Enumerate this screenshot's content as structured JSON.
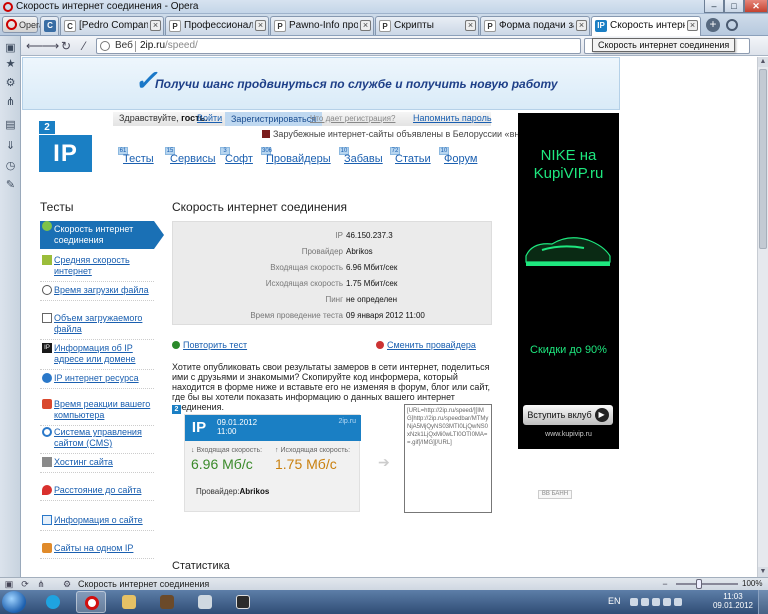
{
  "window": {
    "title": "Скорость интернет соединения - Opera",
    "min": "–",
    "max": "□",
    "close": "✕"
  },
  "opera_button": "Opera",
  "tabs": [
    {
      "label": "[Pedro Company]Про...",
      "favicon": "C",
      "active": false
    },
    {
      "label": "Профессионалы paw...",
      "favicon": "P",
      "active": false
    },
    {
      "label": "Pawno-Info програм...",
      "favicon": "P",
      "active": false
    },
    {
      "label": "Скрипты",
      "favicon": "P",
      "active": false
    },
    {
      "label": "Форма подачи заявки...",
      "favicon": "P",
      "active": false
    },
    {
      "label": "Скорость интернет ...",
      "favicon": "IP",
      "active": true
    }
  ],
  "address": {
    "web_label": "Веб",
    "host": "2ip.ru",
    "path": "/speed/",
    "tooltip": "Скорость интернет соединения"
  },
  "banner": {
    "text": "Получи шанс продвинуться по службе и получить новую работу"
  },
  "logo": {
    "small": "2",
    "big": "IP"
  },
  "userbar": {
    "hello": "Здравствуйте,",
    "guest": "гость.",
    "login": "Войти",
    "register": "Зарегистрироваться",
    "why": "Что дает регистрация?",
    "remind": "Напомнить пароль"
  },
  "news": "Зарубежные интернет-сайты объявлены в Белоруссии «вне закона»",
  "nav": [
    {
      "label": "Тесты",
      "num": "61"
    },
    {
      "label": "Сервисы",
      "num": "15"
    },
    {
      "label": "Софт",
      "num": "3"
    },
    {
      "label": "Провайдеры",
      "num": "306"
    },
    {
      "label": "Забавы",
      "num": "10"
    },
    {
      "label": "Статьи",
      "num": "72"
    },
    {
      "label": "Форум",
      "num": "10"
    }
  ],
  "sidebar_title": "Тесты",
  "main_title": "Скорость интернет соединения",
  "menu": [
    {
      "label": "Скорость интернет соединения",
      "active": true
    },
    {
      "label": "Средняя скорость интернет",
      "active": false
    },
    {
      "label": "Время загрузки файла",
      "active": false
    },
    {
      "label": "Объем загружаемого файла",
      "active": false
    },
    {
      "label": "Информация об IP адресе или домене",
      "active": false
    },
    {
      "label": "IP интернет ресурса",
      "active": false
    },
    {
      "label": "Время реакции вашего компьютера",
      "active": false
    },
    {
      "label": "Система управления сайтом (CMS)",
      "active": false
    },
    {
      "label": "Хостинг сайта",
      "active": false
    },
    {
      "label": "Расстояние до сайта",
      "active": false
    },
    {
      "label": "Информация о сайте",
      "active": false
    },
    {
      "label": "Сайты на одном IP",
      "active": false
    }
  ],
  "results": [
    {
      "label": "IP",
      "value": "46.150.237.3"
    },
    {
      "label": "Провайдер",
      "value": "Abrikos"
    },
    {
      "label": "Входящая скорость",
      "value": "6.96 Мбит/сек"
    },
    {
      "label": "Исходящая скорость",
      "value": "1.75 Мбит/сек"
    },
    {
      "label": "Пинг",
      "value": "не определен"
    },
    {
      "label": "Время проведение теста",
      "value": "09 января 2012 11:00"
    }
  ],
  "repeat_test": "Повторить тест",
  "change_server": "Сменить провайдера",
  "description": "Хотите опубликовать свои результаты замеров в сети интернет, поделиться ими с друзьями и знакомыми? Скопируйте код информера, который находится в форме ниже и вставьте его не изменяя в форум, блог или сайт, где бы вы хотели показать информацию о данных вашего интернет соединения.",
  "informer": {
    "tag": "2",
    "logo": "IP",
    "date": "09.01.2012",
    "time": "11:00",
    "site": "2ip.ru",
    "in_label": "↓ Входящая скорость:",
    "in_value": "6.96 Мб/с",
    "out_label": "↑ Исходящая скорость:",
    "out_value": "1.75 Мб/с",
    "provider_label": "Провайдер:",
    "provider_value": "Abrikos"
  },
  "code": "[URL=http://2ip.ru/speed/][IMG]http://2ip.ru/speedbar/MTMyNjA5MjQyNS03MTI0LjQwNS0xNzk1LjQxMi0wLTI0OTI0MA==.gif[/IMG][/URL]",
  "stats_title": "Статистика",
  "ad": {
    "line1": "NIKE на",
    "line2": "KupiVIP.ru",
    "discount": "Скидки до 90%",
    "cta": "Вступить вклуб",
    "domain": "www.kupivip.ru",
    "tag": "ВВ БАНН"
  },
  "status": {
    "text": "Скорость интернет соединения",
    "zoom": "100%"
  },
  "taskbar": {
    "lang": "EN",
    "time": "11:03",
    "date": "09.01.2012"
  }
}
